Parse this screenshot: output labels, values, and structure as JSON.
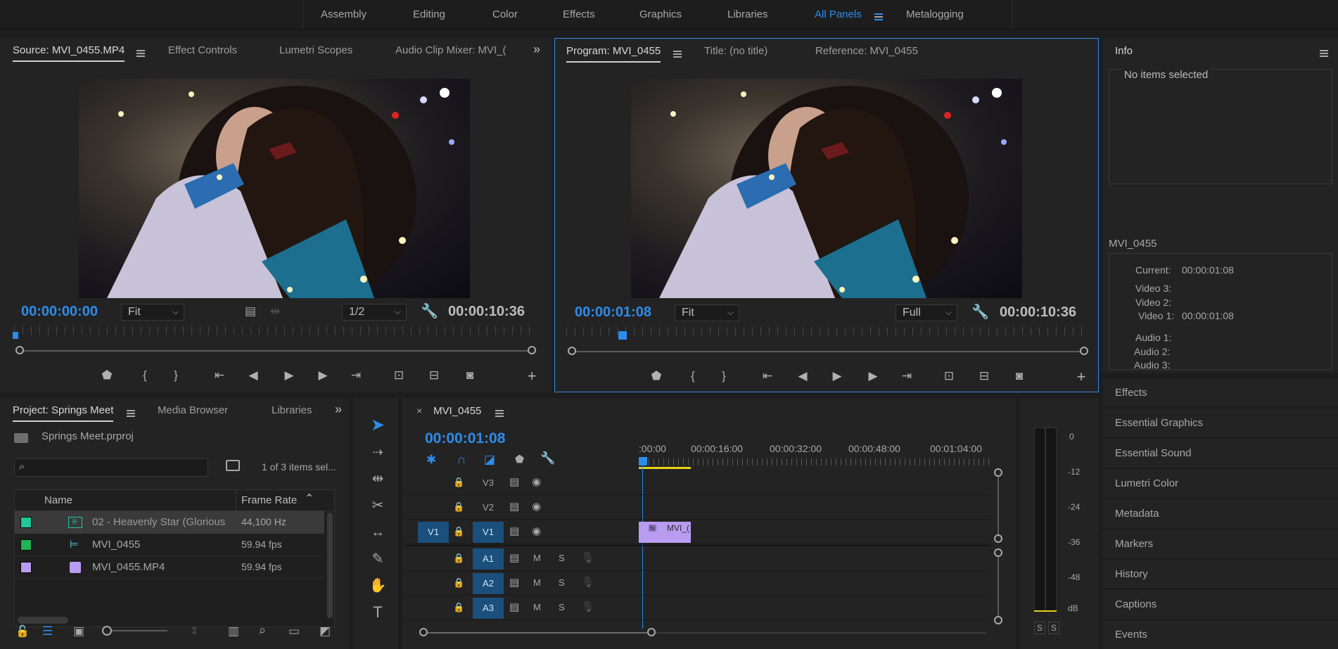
{
  "workspaces": [
    "Assembly",
    "Editing",
    "Color",
    "Effects",
    "Graphics",
    "Libraries",
    "All Panels",
    "Metalogging"
  ],
  "active_workspace": "All Panels",
  "source": {
    "tabs": [
      "Source: MVI_0455.MP4",
      "Effect Controls",
      "Lumetri Scopes",
      "Audio Clip Mixer: MVI_("
    ],
    "timecode_in": "00:00:00:00",
    "fit": "Fit",
    "resolution": "1/2",
    "duration": "00:00:10:36"
  },
  "program": {
    "tabs": [
      "Program: MVI_0455",
      "Title: (no title)",
      "Reference: MVI_0455"
    ],
    "timecode": "00:00:01:08",
    "fit": "Fit",
    "resolution": "Full",
    "duration": "00:00:10:36"
  },
  "info": {
    "title": "Info",
    "no_items": "No items selected",
    "clip_name": "MVI_0455",
    "current_label": "Current:",
    "current_value": "00:00:01:08",
    "video3": "Video 3:",
    "video2": "Video 2:",
    "video1": "Video 1:",
    "video1_value": "00:00:01:08",
    "audio1": "Audio 1:",
    "audio2": "Audio 2:",
    "audio3": "Audio 3:"
  },
  "right_panels": [
    "Effects",
    "Essential Graphics",
    "Essential Sound",
    "Lumetri Color",
    "Metadata",
    "Markers",
    "History",
    "Captions",
    "Events"
  ],
  "project": {
    "tabs": [
      "Project: Springs Meet",
      "Media Browser",
      "Libraries"
    ],
    "file": "Springs Meet.prproj",
    "count": "1 of 3 items sel...",
    "search_placeholder": "",
    "col_name": "Name",
    "col_rate": "Frame Rate",
    "items": [
      {
        "name": "02 - Heavenly Star (Glorious",
        "rate": "44,100 Hz",
        "color": "#1ec99a"
      },
      {
        "name": "MVI_0455",
        "rate": "59.94 fps",
        "color": "#20b455"
      },
      {
        "name": "MVI_0455.MP4",
        "rate": "59.94 fps",
        "color": "#b99cf0"
      }
    ]
  },
  "timeline": {
    "close": "×",
    "title": "MVI_0455",
    "timecode": "00:00:01:08",
    "ruler": [
      ":00:00",
      "00:00:16:00",
      "00:00:32:00",
      "00:00:48:00",
      "00:01:04:00"
    ],
    "clip": "MVI_(",
    "fx": "fx",
    "video_tracks": [
      "V3",
      "V2",
      "V1"
    ],
    "audio_tracks": [
      "A1",
      "A2",
      "A3"
    ],
    "source_patch": "V1",
    "m": "M",
    "s": "S"
  },
  "meter": {
    "labels": [
      "0",
      "-12",
      "-24",
      "-36",
      "-48",
      "dB"
    ],
    "solo": [
      "S",
      "S"
    ]
  }
}
